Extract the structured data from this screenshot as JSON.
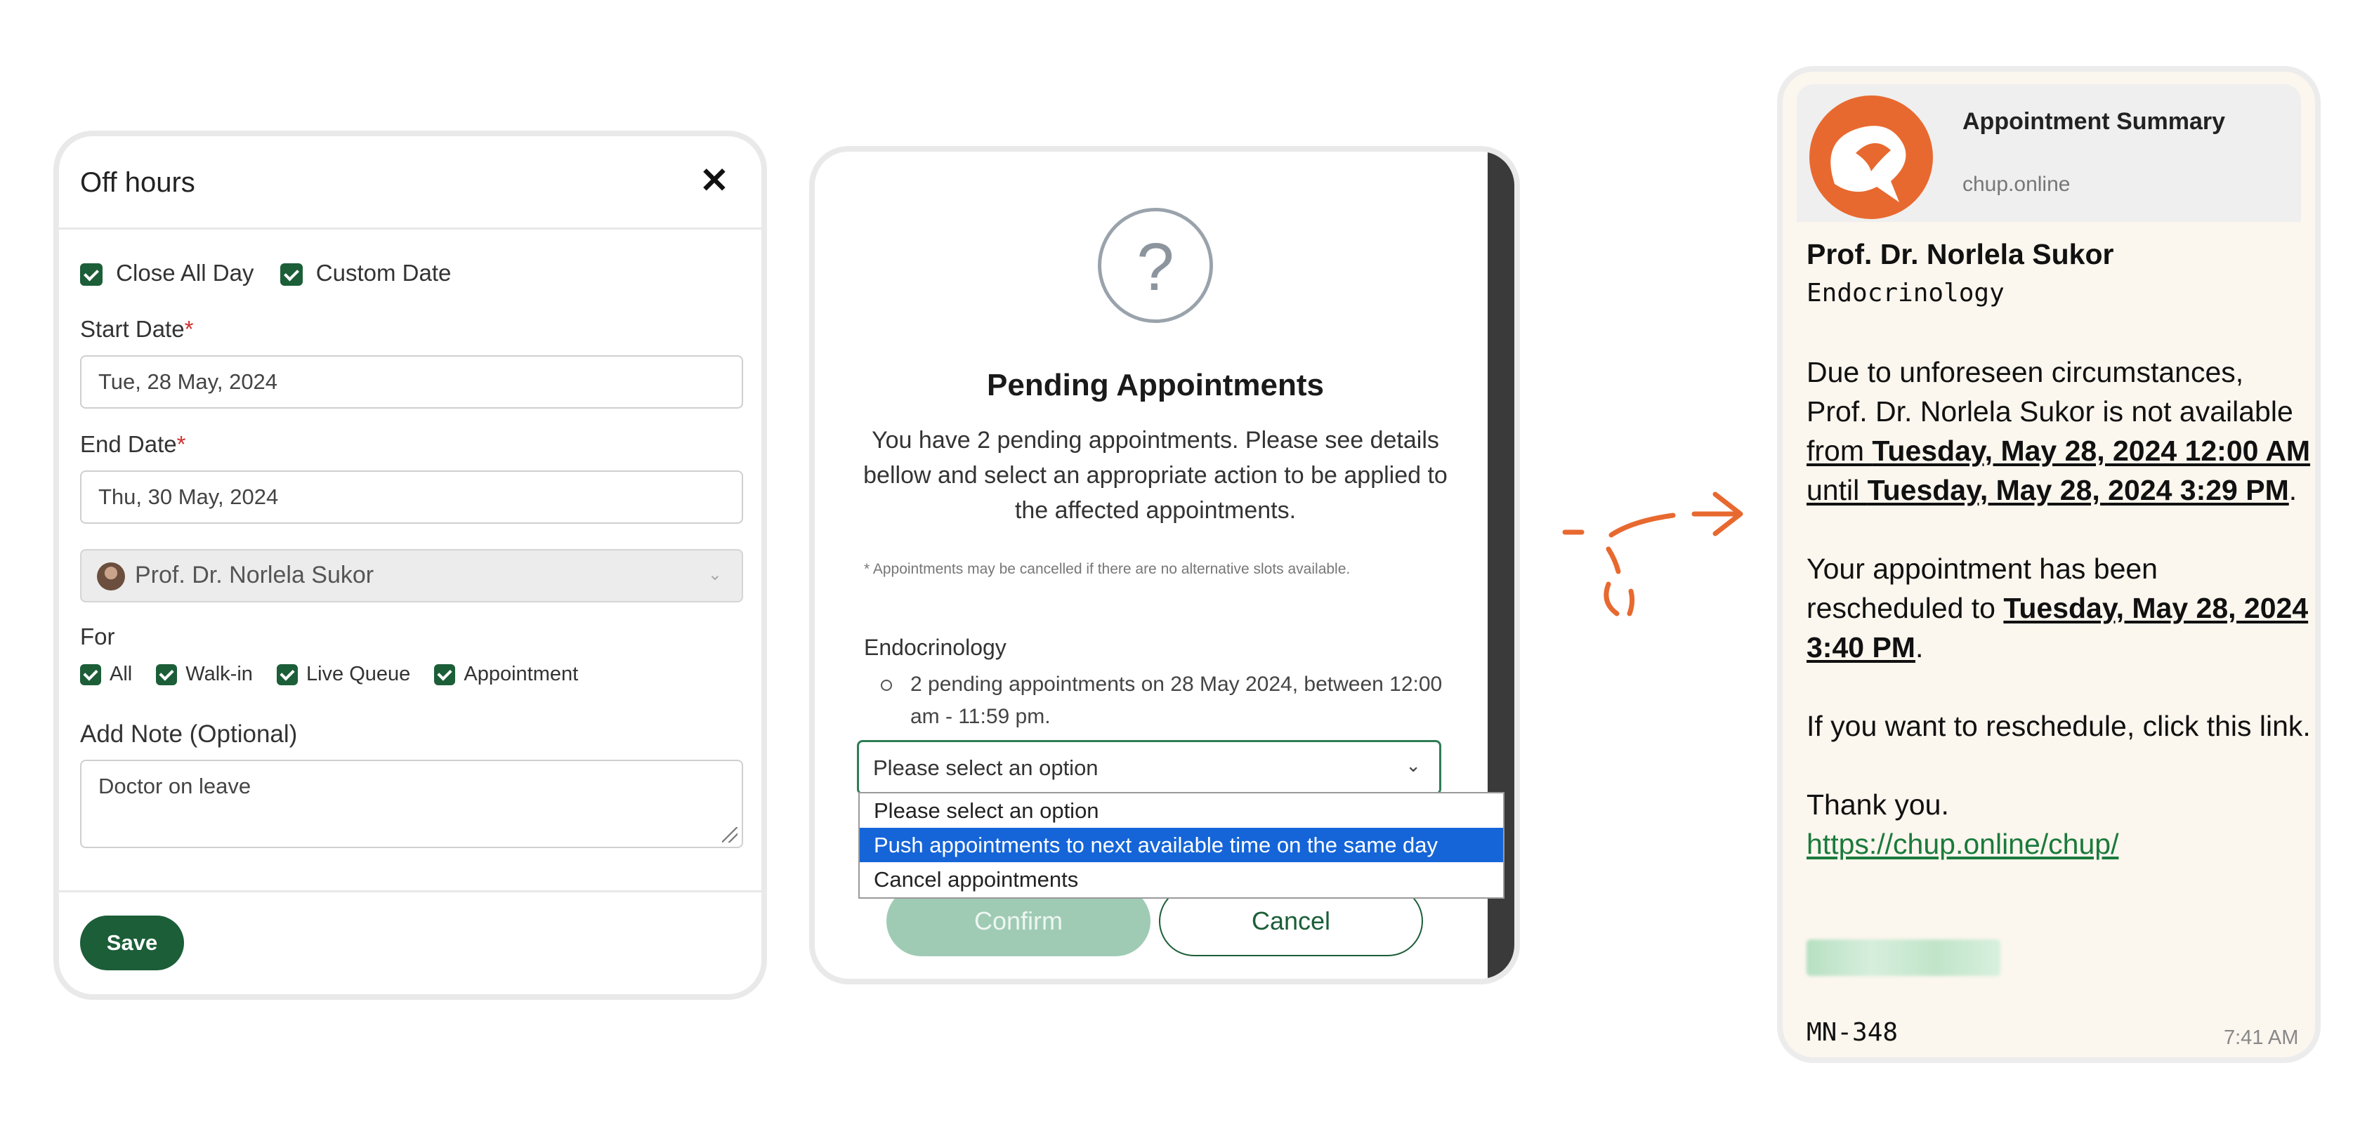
{
  "off_hours": {
    "title": "Off hours",
    "close_icon": "✕",
    "close_all_day": "Close All Day",
    "custom_date": "Custom Date",
    "start_date_label": "Start Date",
    "start_date_value": "Tue, 28 May, 2024",
    "end_date_label": "End Date",
    "end_date_value": "Thu, 30 May, 2024",
    "required_mark": "*",
    "doctor": "Prof. Dr. Norlela Sukor",
    "for_label": "For",
    "for_options": [
      "All",
      "Walk-in",
      "Live Queue",
      "Appointment"
    ],
    "note_label": "Add Note (Optional)",
    "note_value": "Doctor on leave",
    "save_label": "Save"
  },
  "pending": {
    "question_icon": "?",
    "title": "Pending Appointments",
    "description": "You have 2 pending appointments. Please see details bellow and select an appropriate action to be applied to the affected appointments.",
    "footnote": "* Appointments may be cancelled if there are no alternative slots available.",
    "department": "Endocrinology",
    "item": "2 pending appointments on 28 May 2024, between 12:00 am - 11:59 pm.",
    "select_value": "Please select an option",
    "options": [
      "Please select an option",
      "Push appointments to next available time on the same day",
      "Cancel appointments"
    ],
    "confirm_label": "Confirm",
    "cancel_label": "Cancel"
  },
  "message": {
    "preview_title": "Appointment Summary",
    "preview_domain": "chup.online",
    "doctor": "Prof. Dr. Norlela Sukor",
    "department": "Endocrinology",
    "p1_a": "Due to unforeseen circumstances, Prof. Dr. Norlela Sukor is not available ",
    "p1_from": "from ",
    "p1_from_date": "Tuesday, May 28, 2024 12:00 AM",
    "p1_until": " until ",
    "p1_until_date": "Tuesday, May 28, 2024 3:29 PM",
    "p1_end": ".",
    "p2_a": "Your appointment has been rescheduled to ",
    "p2_date": "Tuesday, May 28, 2024 3:40 PM",
    "p2_end": ".",
    "p3": "If you want to reschedule, click this link.",
    "p4": "Thank you.",
    "link": "https://chup.online/chup/",
    "code": "MN-348",
    "time": "7:41 AM"
  },
  "colors": {
    "brand_green": "#1b5e38",
    "accent_orange": "#e8692f",
    "select_blue": "#1565d8"
  }
}
